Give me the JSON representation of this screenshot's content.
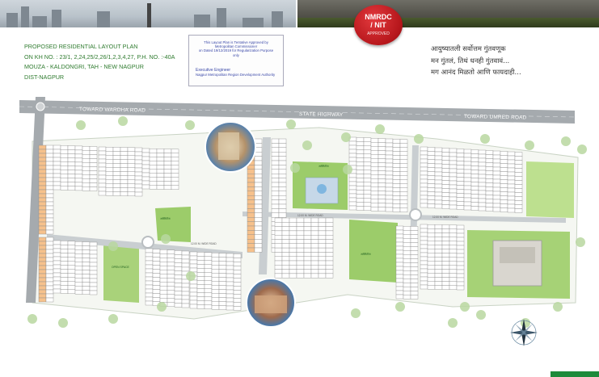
{
  "header": {
    "plan_title": "PROPOSED RESIDENTIAL LAYOUT PLAN",
    "khasra": "ON KH NO. : 23/1, 2,24,25/2,26/1,2,3,4,27, P.H. NO. :-40A",
    "mouza": "MOUZA - KALDONGRI, TAH - NEW NAGPUR",
    "district": "DIST-NAGPUR"
  },
  "seal": {
    "line1": "NMRDC",
    "line2": "/ NIT",
    "line3": "APPROVED",
    "color": "#c0171d"
  },
  "approval_box": {
    "line1": "This Layout Plan is Tentative Approved by",
    "line2": "Metropolitan Commissioner",
    "line3": "on Dated 19/12/2019 for Regularization Purpose only",
    "signature": "Executive Engineer",
    "authority": "Nagpur Metropolitan Region Development Authority"
  },
  "tagline": {
    "line1": "आयुष्यातली सर्वोत्तम गुंतवणूक",
    "line2": "मन गुंतलं, तिथं धनही गुंतवावं...",
    "line3": "मग आनंद मिळतो आणि फायदाही..."
  },
  "map": {
    "road_wardha": "TOWARD WARDHA ROAD",
    "road_state": "STATE HIGHWAY",
    "road_umred": "TOWARD UMRED ROAD",
    "wide_road": "12.00 M. WIDE ROAD",
    "garden_label": "अमेनिटीज",
    "open_space": "OPEN SPACE",
    "green": "#9ccc6a",
    "plot_fill": "#ffffff",
    "corner_plot_fill": "#f6c18c",
    "plot_border": "#8a8a8a",
    "highway": "#a5aaae"
  },
  "compass": {
    "north": "N"
  }
}
